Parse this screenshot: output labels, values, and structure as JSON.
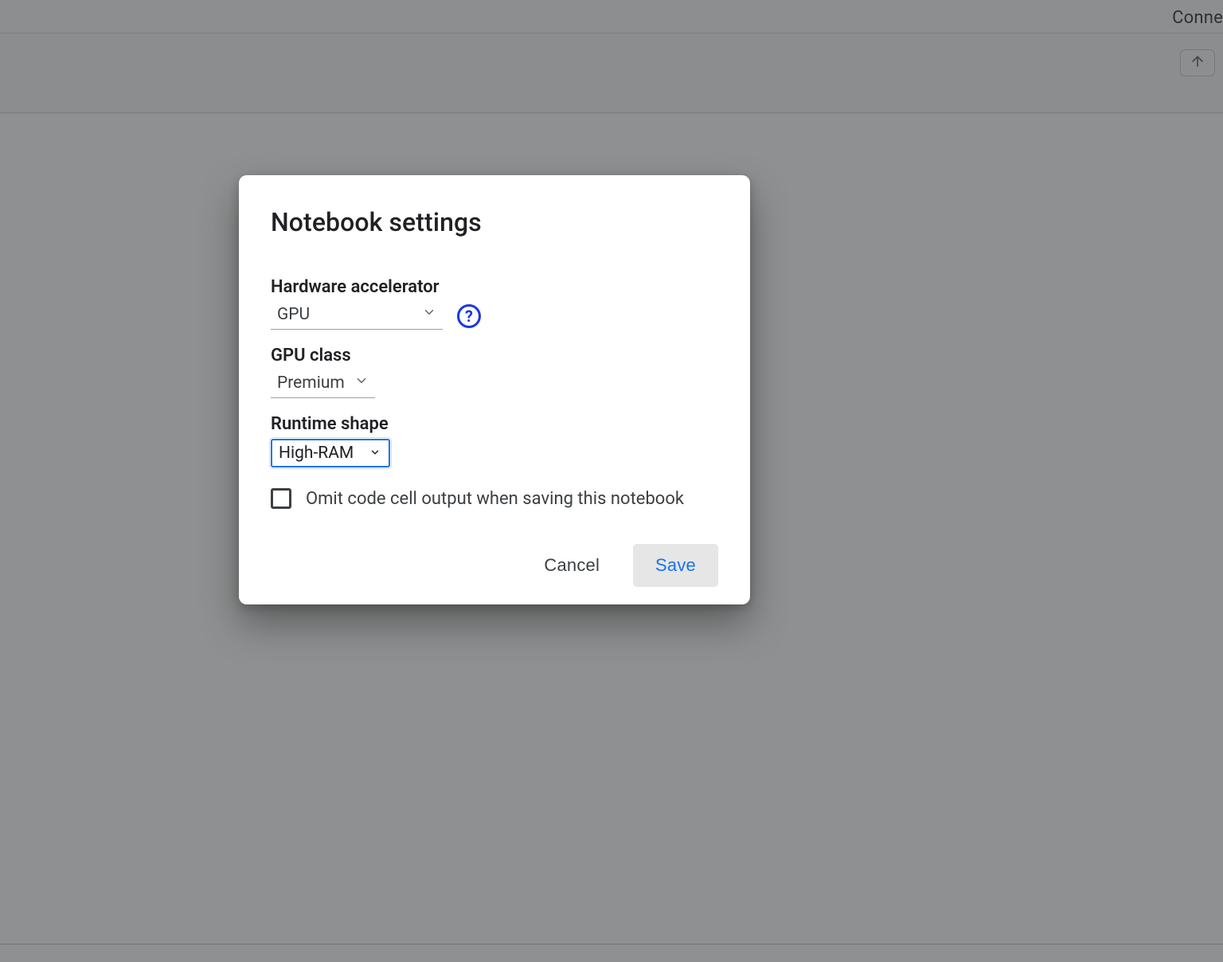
{
  "header": {
    "connect_label": "Conne"
  },
  "dialog": {
    "title": "Notebook settings",
    "hardware_accel": {
      "label": "Hardware accelerator",
      "value": "GPU"
    },
    "gpu_class": {
      "label": "GPU class",
      "value": "Premium"
    },
    "runtime_shape": {
      "label": "Runtime shape",
      "value": "High-RAM"
    },
    "omit_output": {
      "label": "Omit code cell output when saving this notebook",
      "checked": false
    },
    "actions": {
      "cancel": "Cancel",
      "save": "Save"
    }
  }
}
